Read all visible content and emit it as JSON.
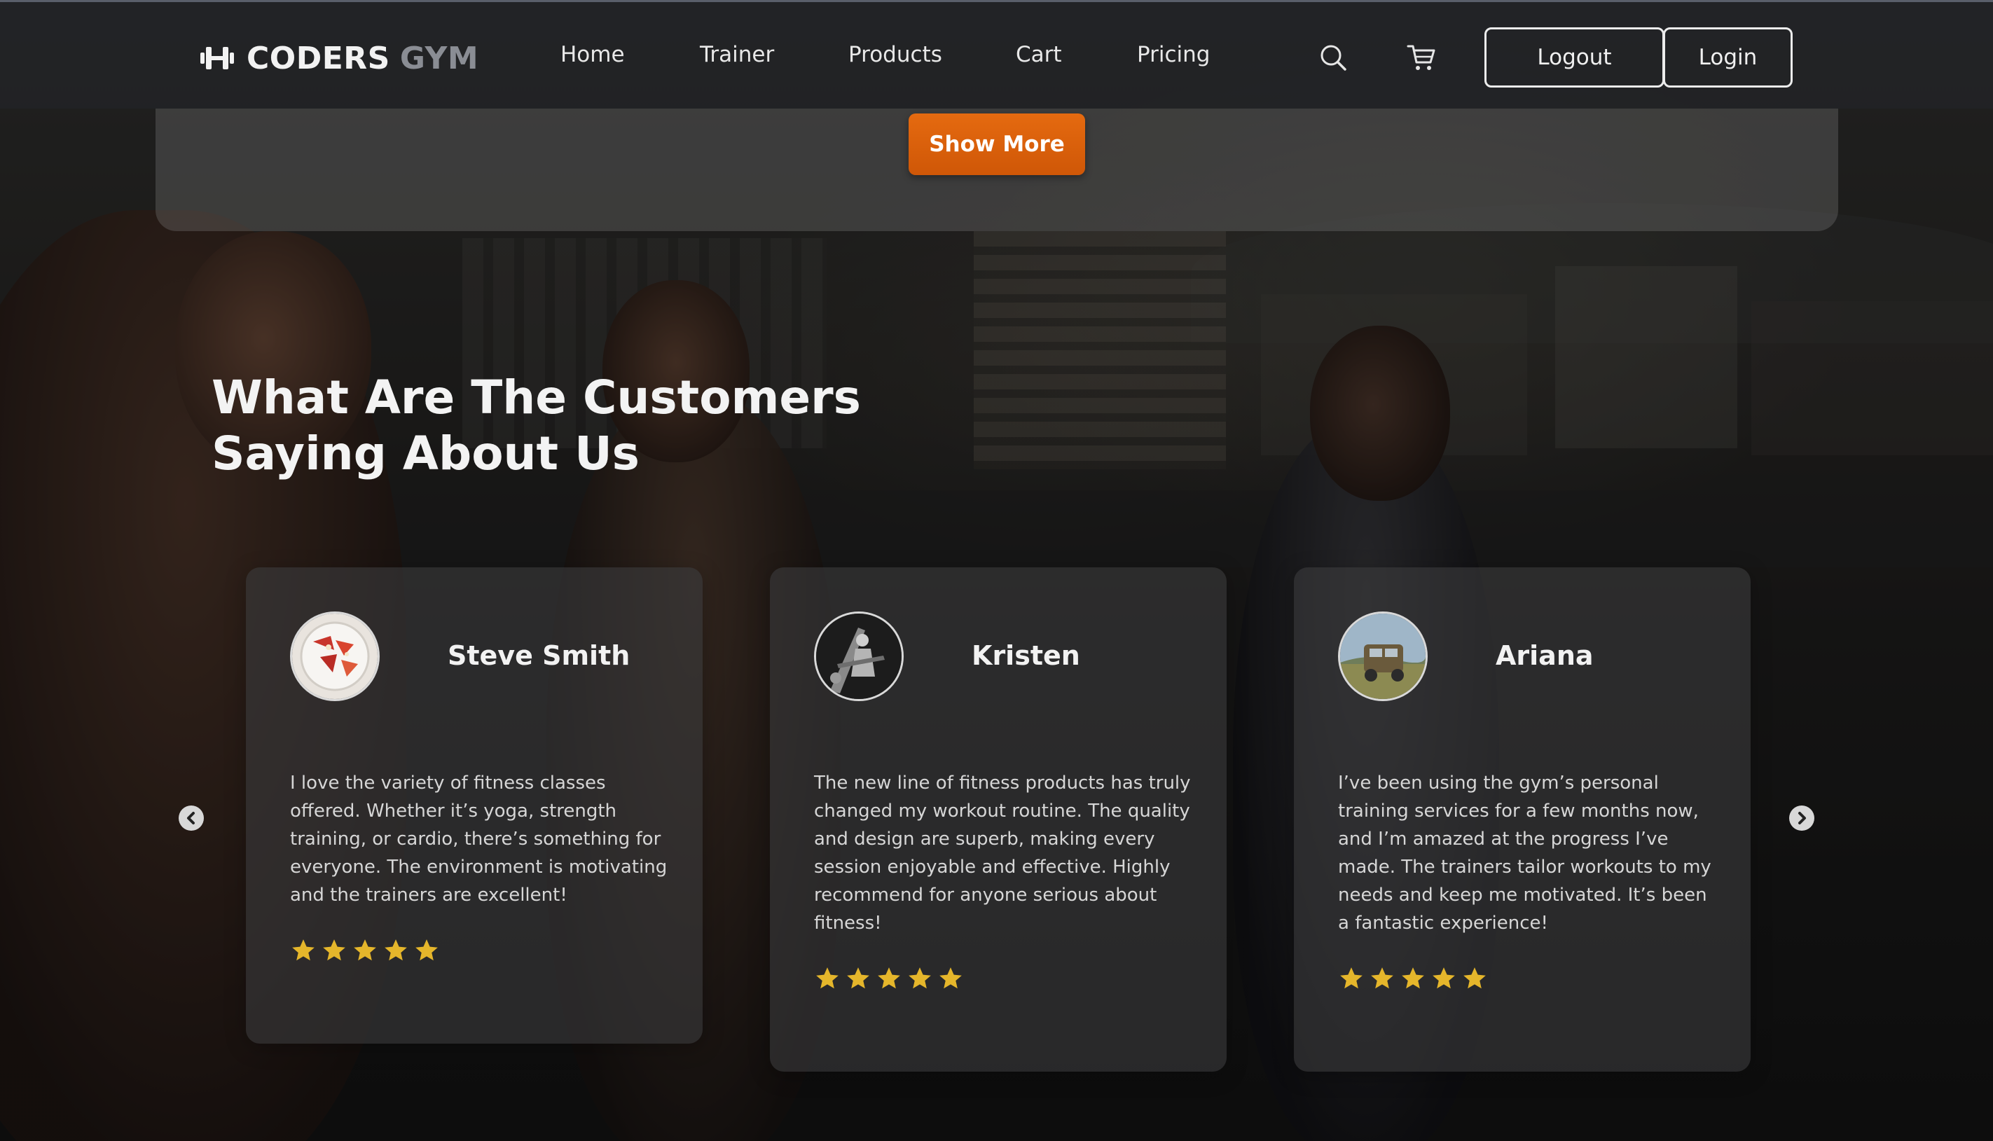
{
  "navbar": {
    "logo_word1": "CODERS",
    "logo_word2": "GYM",
    "links": [
      "Home",
      "Trainer",
      "Products",
      "Cart",
      "Pricing"
    ],
    "icons": [
      "search-icon",
      "cart-icon"
    ],
    "logout_label": "Logout",
    "login_label": "Login"
  },
  "previous_section": {
    "show_more_label": "Show More"
  },
  "testimonials": {
    "title_line1": "What Are The Customers",
    "title_line2": "Saying About Us",
    "cards": [
      {
        "name": "Steve Smith",
        "quote": "I love the variety of fitness classes offered. Whether it’s yoga, strength training, or cardio, there’s something for everyone. The environment is motivating and the trainers are excellent!",
        "rating": 5
      },
      {
        "name": "Kristen",
        "quote": "The new line of fitness products has truly changed my workout routine. The quality and design are superb, making every session enjoyable and effective. Highly recommend for anyone serious about fitness!",
        "rating": 5
      },
      {
        "name": "Ariana",
        "quote": "I’ve been using the gym’s personal training services for a few months now, and I’m amazed at the progress I’ve made. The trainers tailor workouts to my needs and keep me motivated. It’s been a fantastic experience!",
        "rating": 5
      }
    ],
    "prev_icon": "chevron-left-icon",
    "next_icon": "chevron-right-icon"
  },
  "colors": {
    "accent": "#e56a10",
    "star": "#e5b62b",
    "navbar_bg": "#222326",
    "logo_secondary": "#8a8d94"
  }
}
